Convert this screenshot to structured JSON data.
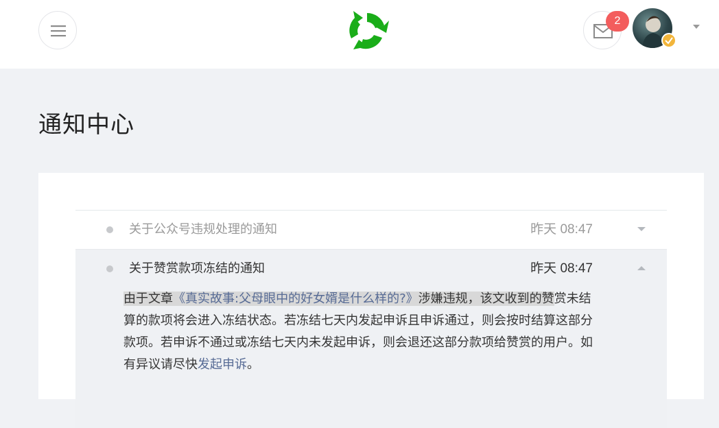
{
  "header": {
    "notification_count": "2",
    "logo_color": "#1aad19"
  },
  "page": {
    "title": "通知中心"
  },
  "notifications": [
    {
      "title": "关于公众号违规处理的通知",
      "time": "昨天 08:47",
      "expanded": false
    },
    {
      "title": "关于赞赏款项冻结的通知",
      "time": "昨天 08:47",
      "expanded": true,
      "body": {
        "prefix": "由于文章",
        "article_link": "《真实故事:父母眼中的好女婿是什么样的?》",
        "after_link": "涉嫌违规，该文收到的赞",
        "main": "赏未结算的款项将会进入冻结状态。若冻结七天内发起申诉且申诉通过，则会按时结算这部分款项。若申诉不通过或冻结七天内未发起申诉，则会退还这部分款项给赞赏的用户。如有异议请尽快",
        "appeal_link": "发起申诉",
        "suffix": "。"
      }
    }
  ],
  "colors": {
    "badge": "#f35d5d",
    "link": "#576b95",
    "highlight": "#d8d8d8"
  },
  "icons": [
    "menu-icon",
    "logo-icon",
    "mail-icon",
    "avatar",
    "verified-icon",
    "caret-down-icon",
    "chevron-down-icon",
    "chevron-up-icon"
  ]
}
